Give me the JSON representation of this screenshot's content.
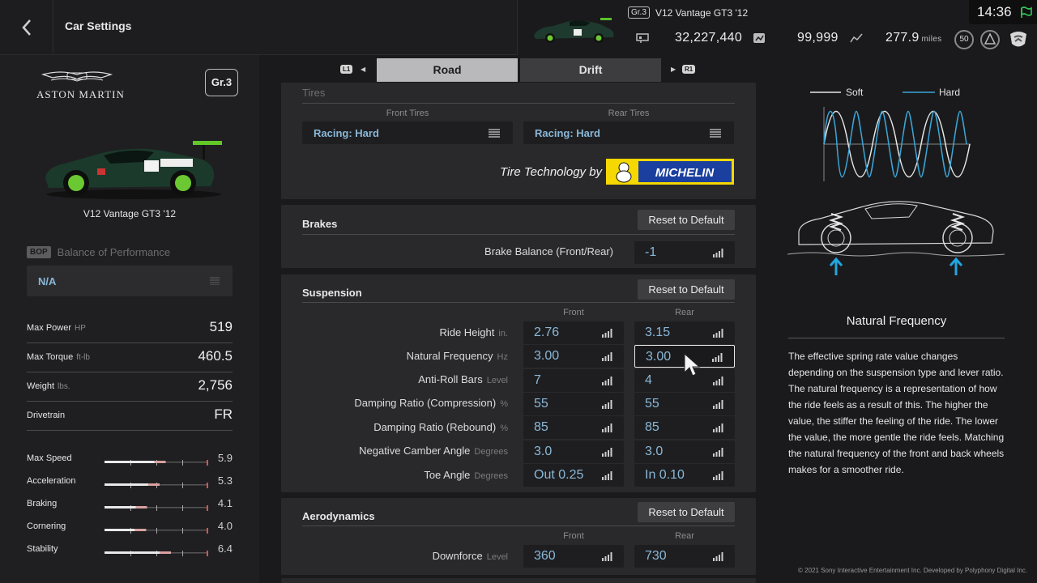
{
  "header": {
    "title": "Car Settings",
    "car_class": "Gr.3",
    "car_name": "V12 Vantage GT3 '12",
    "credits": "32,227,440",
    "mileage_points": "99,999",
    "distance": "277.9",
    "distance_unit": "miles",
    "clock": "14:36",
    "level": "50"
  },
  "left": {
    "brand": "ASTON MARTIN",
    "class_badge": "Gr.3",
    "car_name": "V12 Vantage GT3 '12",
    "bop_tag": "BOP",
    "bop_label": "Balance of Performance",
    "bop_value": "N/A",
    "specs": [
      {
        "label": "Max Power",
        "unit": "HP",
        "value": "519"
      },
      {
        "label": "Max Torque",
        "unit": "ft-lb",
        "value": "460.5"
      },
      {
        "label": "Weight",
        "unit": "lbs.",
        "value": "2,756"
      },
      {
        "label": "Drivetrain",
        "unit": "",
        "value": "FR"
      }
    ],
    "performance": [
      {
        "label": "Max Speed",
        "value": "5.9",
        "level": 0.59
      },
      {
        "label": "Acceleration",
        "value": "5.3",
        "level": 0.53
      },
      {
        "label": "Braking",
        "value": "4.1",
        "level": 0.41
      },
      {
        "label": "Cornering",
        "value": "4.0",
        "level": 0.4
      },
      {
        "label": "Stability",
        "value": "6.4",
        "level": 0.64
      }
    ]
  },
  "tabs": {
    "left_button": "L1",
    "right_button": "R1",
    "road": "Road",
    "drift": "Drift"
  },
  "tires": {
    "title": "Tires",
    "front_header": "Front Tires",
    "rear_header": "Rear Tires",
    "front_value": "Racing: Hard",
    "rear_value": "Racing: Hard",
    "sponsor_text": "Tire Technology by",
    "sponsor_logo": "MICHELIN"
  },
  "brakes": {
    "title": "Brakes",
    "reset_label": "Reset to Default",
    "balance_label": "Brake Balance (Front/Rear)",
    "balance_value": "-1"
  },
  "suspension": {
    "title": "Suspension",
    "reset_label": "Reset to Default",
    "front_header": "Front",
    "rear_header": "Rear",
    "rows": [
      {
        "label": "Ride Height",
        "unit": "in.",
        "front": "2.76",
        "rear": "3.15"
      },
      {
        "label": "Natural Frequency",
        "unit": "Hz",
        "front": "3.00",
        "rear": "3.00"
      },
      {
        "label": "Anti-Roll Bars",
        "unit": "Level",
        "front": "7",
        "rear": "4"
      },
      {
        "label": "Damping Ratio (Compression)",
        "unit": "%",
        "front": "55",
        "rear": "55"
      },
      {
        "label": "Damping Ratio (Rebound)",
        "unit": "%",
        "front": "85",
        "rear": "85"
      },
      {
        "label": "Negative Camber Angle",
        "unit": "Degrees",
        "front": "3.0",
        "rear": "3.0"
      },
      {
        "label": "Toe Angle",
        "unit": "Degrees",
        "front": "Out 0.25",
        "rear": "In 0.10"
      }
    ]
  },
  "aero": {
    "title": "Aerodynamics",
    "reset_label": "Reset to Default",
    "front_header": "Front",
    "rear_header": "Rear",
    "downforce_label": "Downforce",
    "downforce_unit": "Level",
    "front": "360",
    "rear": "730"
  },
  "info": {
    "legend_soft": "Soft",
    "legend_hard": "Hard",
    "title": "Natural Frequency",
    "body": "The effective spring rate value changes depending on the suspension type and lever ratio. The natural frequency is a representation of how the ride feels as a result of this. The higher the value, the stiffer the feeling of the ride. The lower the value, the more gentle the ride feels. Matching the natural frequency of the front and back wheels makes for a smoother ride.",
    "copyright": "© 2021 Sony Interactive Entertainment Inc. Developed by Polyphony Digital Inc."
  },
  "colors": {
    "value_blue": "#8ab8d8",
    "accent_green": "#34c759",
    "hard_line": "#3aa6d8",
    "soft_line": "#e6e6e6",
    "perf_red": "#d9534f"
  },
  "icons": [
    "back-chevron-icon",
    "credits-icon",
    "mileage-icon",
    "distance-icon",
    "racing-flag-icon",
    "menu-icon",
    "signal-bars-icon",
    "cursor-arrow-icon"
  ]
}
